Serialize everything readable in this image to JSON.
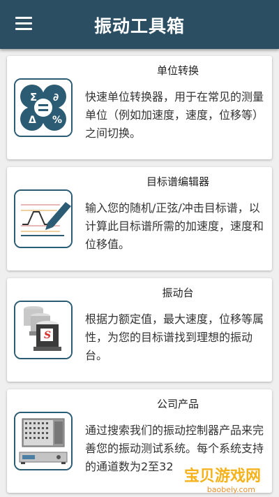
{
  "app": {
    "title": "振动工具箱",
    "menu_icon": "hamburger-menu-icon"
  },
  "cards": [
    {
      "title": "单位转换",
      "description": "快速单位转换器，用于在常见的测量单位（例如加速度，速度，位移等）之间切换。",
      "icon": "unit-converter-icon"
    },
    {
      "title": "目标谱编辑器",
      "description": "输入您的随机/正弦/冲击目标谱，以计算此目标谱所需的加速度，速度和位移值。",
      "icon": "profile-editor-icon"
    },
    {
      "title": "振动台",
      "description": "根据力额定值，最大速度，位移等属性，为您的目标谱找到理想的振动台。",
      "icon": "shaker-icon"
    },
    {
      "title": "公司产品",
      "description": "通过搜索我们的振动控制器产品来完善您的振动测试系统。每个系统支持的通道数为2至32",
      "icon": "controller-icon"
    }
  ],
  "watermark": {
    "text": "宝贝游戏网",
    "url": "baobeiy.com"
  },
  "colors": {
    "appbar": "#2b4e63",
    "icon_border": "#2b5c73",
    "background": "#efefef"
  }
}
